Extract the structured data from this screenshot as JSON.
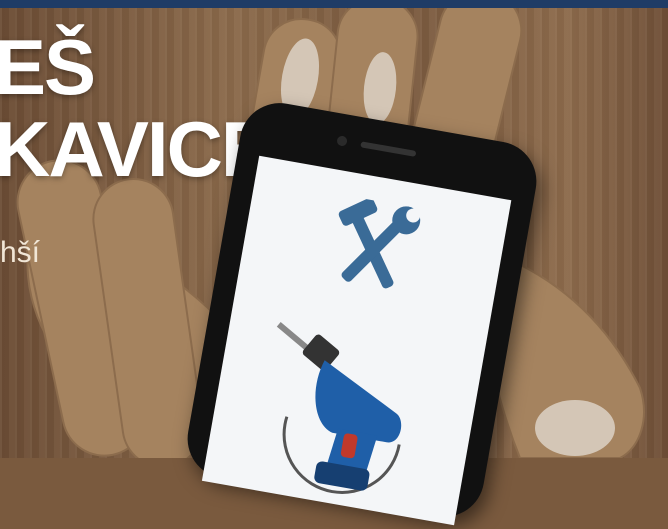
{
  "headline": {
    "line1": "EŠ",
    "line2": "KAVICE."
  },
  "subtext": "hší",
  "icons": {
    "tools": "hammer-wrench-icon",
    "drill": "drill-icon"
  },
  "colors": {
    "top_bar": "#1f3c66",
    "tools_icon": "#3a6b97",
    "drill_body": "#1f5fa8"
  }
}
